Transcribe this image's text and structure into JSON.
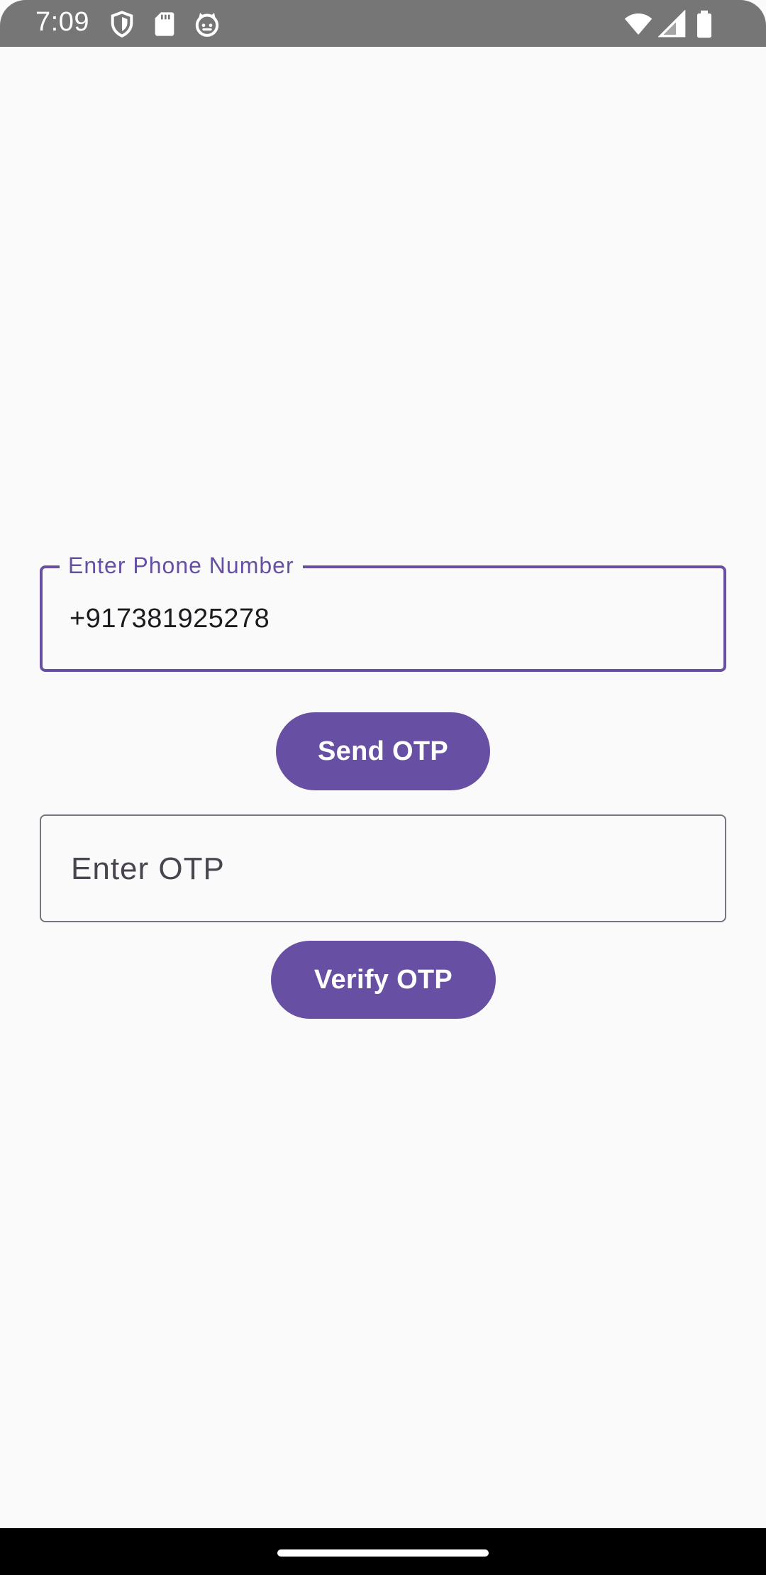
{
  "status_bar": {
    "time": "7:09",
    "left_icons": [
      "shield-icon",
      "sd-card-icon",
      "cat-face-icon"
    ],
    "right_icons": [
      "wifi-icon",
      "signal-icon",
      "battery-icon"
    ]
  },
  "phone_field": {
    "label": "Enter Phone Number",
    "value": "+917381925278"
  },
  "send_button": {
    "label": "Send OTP"
  },
  "otp_field": {
    "placeholder": "Enter OTP",
    "value": ""
  },
  "verify_button": {
    "label": "Verify OTP"
  },
  "colors": {
    "primary": "#6750a4",
    "background": "#fafafa",
    "status_bar": "#767676",
    "outline": "#79747e"
  }
}
